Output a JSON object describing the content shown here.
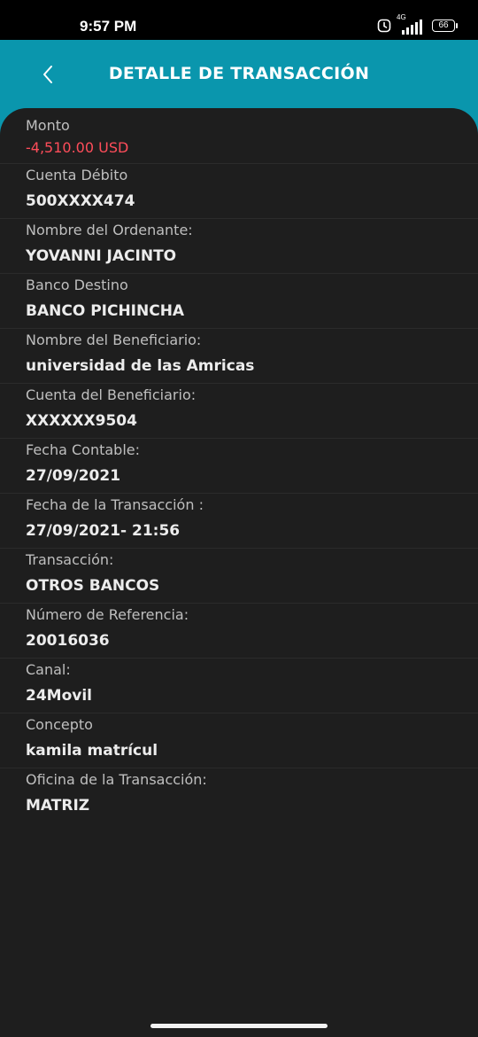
{
  "status_bar": {
    "time": "9:57 PM",
    "network": "4G",
    "battery": "66"
  },
  "header": {
    "title": "DETALLE DE TRANSACCIÓN"
  },
  "details": [
    {
      "label": "Monto",
      "value": "-4,510.00 USD"
    },
    {
      "label": "Cuenta Débito",
      "value": "500XXXX474"
    },
    {
      "label": "Nombre del Ordenante:",
      "value": "YOVANNI JACINTO"
    },
    {
      "label": "Banco Destino",
      "value": "BANCO PICHINCHA"
    },
    {
      "label": "Nombre del Beneficiario:",
      "value": "universidad de las Amricas"
    },
    {
      "label": "Cuenta del Beneficiario:",
      "value": "XXXXXX9504"
    },
    {
      "label": "Fecha Contable:",
      "value": "27/09/2021"
    },
    {
      "label": "Fecha de la Transacción :",
      "value": "27/09/2021- 21:56"
    },
    {
      "label": "Transacción:",
      "value": "OTROS BANCOS"
    },
    {
      "label": "Número de Referencia:",
      "value": "20016036"
    },
    {
      "label": "Canal:",
      "value": "24Movil"
    },
    {
      "label": "Concepto",
      "value": "kamila matrícul"
    },
    {
      "label": "Oficina de la Transacción:",
      "value": "MATRIZ"
    }
  ],
  "colors": {
    "header_bg": "#0a96ad",
    "card_bg": "#1e1e1e",
    "amount": "#ff4d5a"
  }
}
